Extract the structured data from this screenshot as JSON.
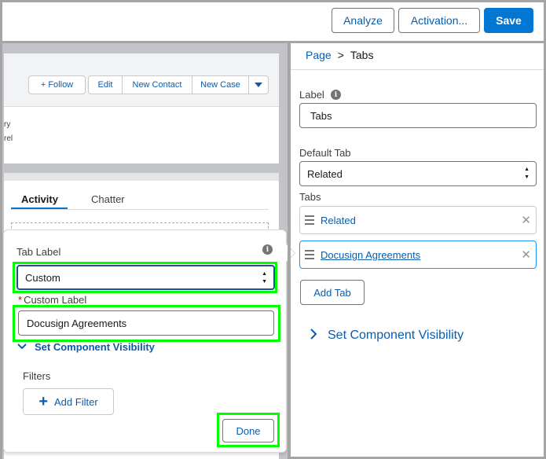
{
  "toolbar": {
    "analyze_label": "Analyze",
    "activation_label": "Activation...",
    "save_label": "Save"
  },
  "canvas": {
    "record_actions": {
      "follow_label": "+ Follow",
      "edit_label": "Edit",
      "new_contact_label": "New Contact",
      "new_case_label": "New Case"
    },
    "field_fragments": [
      "ry",
      "rel"
    ],
    "tabs": [
      {
        "label": "Activity",
        "active": true
      },
      {
        "label": "Chatter",
        "active": false
      }
    ]
  },
  "popover": {
    "tab_label_label": "Tab Label",
    "tab_label_value": "Custom",
    "custom_label_label": "Custom Label",
    "custom_label_value": "Docusign Agreements",
    "visibility_label": "Set Component Visibility",
    "filters_label": "Filters",
    "add_filter_label": "Add Filter",
    "done_label": "Done"
  },
  "properties": {
    "breadcrumb": {
      "page": "Page",
      "separator": ">",
      "current": "Tabs"
    },
    "label_label": "Label",
    "label_value": "Tabs",
    "default_tab_label": "Default Tab",
    "default_tab_value": "Related",
    "tabs_label": "Tabs",
    "tab_items": [
      {
        "label": "Related"
      },
      {
        "label": "Docusign Agreements"
      }
    ],
    "add_tab_label": "Add Tab",
    "visibility_label": "Set Component Visibility"
  },
  "colors": {
    "brand": "#0176d3",
    "link": "#0b5cab",
    "highlight": "#00ff00"
  }
}
